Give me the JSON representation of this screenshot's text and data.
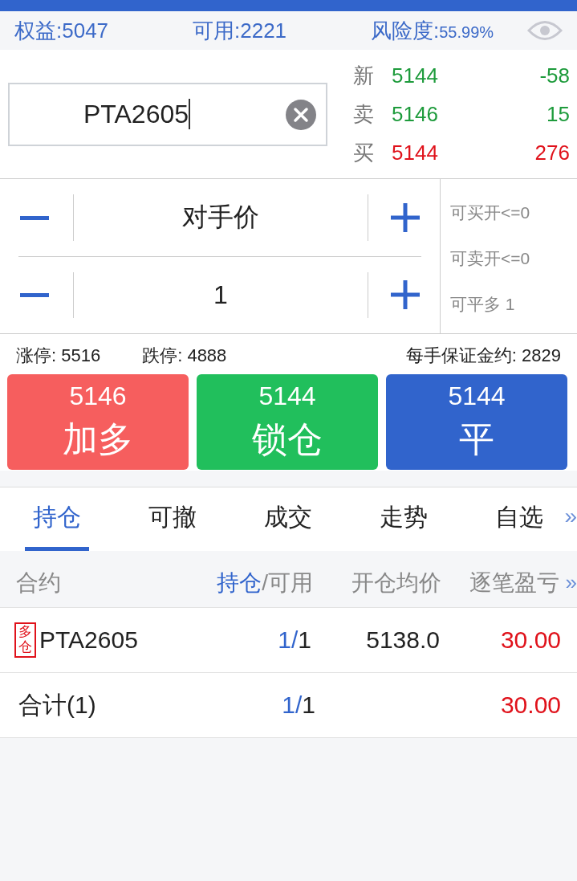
{
  "account": {
    "equity": {
      "label": "权益:",
      "value": "5047"
    },
    "available": {
      "label": "可用:",
      "value": "2221"
    },
    "risk": {
      "label": "风险度:",
      "value": "55.99%"
    }
  },
  "search": {
    "value": "PTA2605"
  },
  "quotes": [
    {
      "label": "新",
      "price": "5144",
      "change": "-58",
      "color": "#1e9b3c"
    },
    {
      "label": "卖",
      "price": "5146",
      "change": "15",
      "color": "#1e9b3c"
    },
    {
      "label": "买",
      "price": "5144",
      "change": "276",
      "color": "#e0121b"
    }
  ],
  "steppers": [
    {
      "value": "对手价"
    },
    {
      "value": "1"
    }
  ],
  "capacity": [
    "可买开<=0",
    "可卖开<=0",
    "可平多 1"
  ],
  "limits": [
    "涨停: 5516",
    "跌停: 4888",
    "每手保证金约: 2829"
  ],
  "actions": [
    {
      "price": "5146",
      "label": "加多",
      "color": "#f65e5e"
    },
    {
      "price": "5144",
      "label": "锁仓",
      "color": "#21bf5c"
    },
    {
      "price": "5144",
      "label": "平",
      "color": "#3164cc"
    }
  ],
  "tabs": [
    {
      "label": "持仓",
      "selected": true
    },
    {
      "label": "可撤",
      "selected": false
    },
    {
      "label": "成交",
      "selected": false
    },
    {
      "label": "走势",
      "selected": false
    },
    {
      "label": "自选",
      "selected": false
    }
  ],
  "tabs_more": "»",
  "table": {
    "columns": [
      {
        "label": "合约"
      },
      {
        "label": "持仓",
        "suffix": "/可用"
      },
      {
        "label": "开仓均价"
      },
      {
        "label": "逐笔盈亏"
      }
    ],
    "columns_more": "»",
    "rows": [
      {
        "tag": "多仓",
        "contract": "PTA2605",
        "held": "1/",
        "available": "1",
        "avg_price": "5138.0",
        "pnl": "30.00"
      }
    ],
    "total": {
      "label": "合计(1)",
      "held": "1/",
      "available": "1",
      "pnl": "30.00"
    }
  }
}
